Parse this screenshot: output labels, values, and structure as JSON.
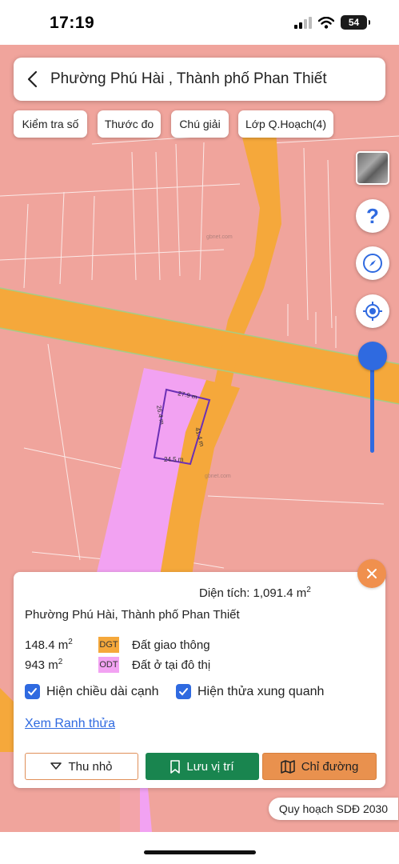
{
  "status_bar": {
    "time": "17:19",
    "battery": "54"
  },
  "search": {
    "text": "Phường Phú Hài , Thành phố Phan Thiết"
  },
  "chips": [
    "Kiểm tra số",
    "Thước đo",
    "Chú giải",
    "Lớp Q.Hoạch(4)"
  ],
  "map": {
    "watermark": "gbnet.com",
    "parcel_edges": {
      "top": "27.9 m",
      "right": "41.4 m",
      "bottom": "24.5 m",
      "left": "26.4 m"
    },
    "colors": {
      "land": "#f0a49c",
      "road": "#f5a83b",
      "urban": "#f2a2f2",
      "parcel_outline": "#6b2fb5"
    }
  },
  "controls": {
    "help_symbol": "?"
  },
  "panel": {
    "area_label": "Diện tích: 1,091.4 m",
    "area_sup": "2",
    "location": "Phường Phú Hài, Thành phố Phan Thiết",
    "zones": [
      {
        "area": "148.4 m",
        "sup": "2",
        "code": "DGT",
        "code_color": "#f5a83b",
        "name": "Đất giao thông"
      },
      {
        "area": "943 m",
        "sup": "2",
        "code": "ODT",
        "code_color": "#f2a2f2",
        "name": "Đất ở tại đô thị"
      }
    ],
    "checkboxes": [
      {
        "label": "Hiện chiều dài cạnh",
        "checked": true
      },
      {
        "label": "Hiện thửa xung quanh",
        "checked": true
      }
    ],
    "link": "Xem Ranh thửa",
    "buttons": {
      "shrink": "Thu nhỏ",
      "save": "Lưu vị trí",
      "route": "Chỉ đường"
    }
  },
  "plan_badge": "Quy hoạch SDĐ 2030"
}
